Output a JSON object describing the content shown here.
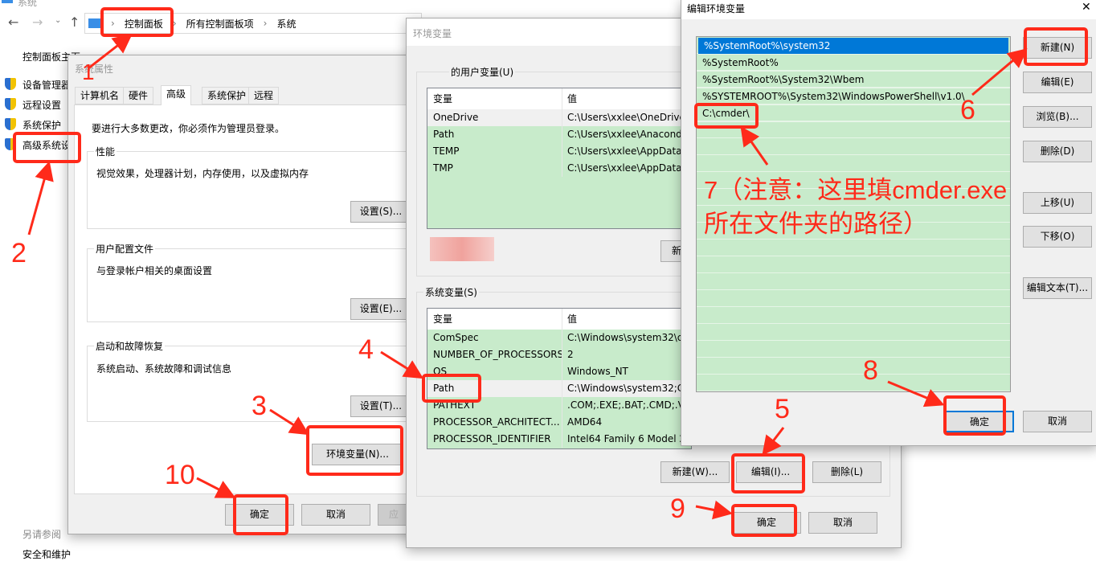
{
  "explorer": {
    "title": "系统",
    "breadcrumb": [
      "控制面板",
      "所有控制面板项",
      "系统"
    ],
    "nav_home": "控制面板主页",
    "nav_items": [
      "设备管理器",
      "远程设置",
      "系统保护",
      "高级系统设"
    ],
    "see_also": "另请参阅",
    "see_also_item": "安全和维护"
  },
  "sysprops": {
    "title": "系统属性",
    "tabs": [
      "计算机名",
      "硬件",
      "高级",
      "系统保护",
      "远程"
    ],
    "active_tab": "高级",
    "admin_note": "要进行大多数更改，你必须作为管理员登录。",
    "performance": {
      "label": "性能",
      "desc": "视觉效果，处理器计划，内存使用，以及虚拟内存",
      "button": "设置(S)..."
    },
    "profile": {
      "label": "用户配置文件",
      "desc": "与登录帐户相关的桌面设置",
      "button": "设置(E)..."
    },
    "startup": {
      "label": "启动和故障恢复",
      "desc": "系统启动、系统故障和调试信息",
      "button": "设置(T)..."
    },
    "env_button": "环境变量(N)...",
    "ok": "确定",
    "cancel": "取消",
    "apply": "应"
  },
  "envvars": {
    "title": "环境变量",
    "user_group": "的用户变量(U)",
    "col_var": "变量",
    "col_val": "值",
    "user_vars": [
      {
        "name": "OneDrive",
        "value": "C:\\Users\\xxlee\\OneDrive"
      },
      {
        "name": "Path",
        "value": "C:\\Users\\xxlee\\Anacond"
      },
      {
        "name": "TEMP",
        "value": "C:\\Users\\xxlee\\AppData\\"
      },
      {
        "name": "TMP",
        "value": "C:\\Users\\xxlee\\AppData\\"
      }
    ],
    "user_new": "新",
    "sys_group": "系统变量(S)",
    "sys_vars": [
      {
        "name": "ComSpec",
        "value": "C:\\Windows\\system32\\c"
      },
      {
        "name": "NUMBER_OF_PROCESSORS",
        "value": "2"
      },
      {
        "name": "OS",
        "value": "Windows_NT"
      },
      {
        "name": "Path",
        "value": "C:\\Windows\\system32;C"
      },
      {
        "name": "PATHEXT",
        "value": ".COM;.EXE;.BAT;.CMD;.V"
      },
      {
        "name": "PROCESSOR_ARCHITECT...",
        "value": "AMD64"
      },
      {
        "name": "PROCESSOR_IDENTIFIER",
        "value": "Intel64 Family 6 Model 2"
      }
    ],
    "new": "新建(W)...",
    "edit": "编辑(I)...",
    "delete": "删除(L)",
    "ok": "确定",
    "cancel": "取消"
  },
  "editenv": {
    "title": "编辑环境变量",
    "close": "✕",
    "entries": [
      "%SystemRoot%\\system32",
      "%SystemRoot%",
      "%SystemRoot%\\System32\\Wbem",
      "%SYSTEMROOT%\\System32\\WindowsPowerShell\\v1.0\\",
      "C:\\cmder\\"
    ],
    "buttons": [
      "新建(N)",
      "编辑(E)",
      "浏览(B)...",
      "删除(D)",
      "上移(U)",
      "下移(O)",
      "编辑文本(T)..."
    ],
    "ok": "确定",
    "cancel": "取消"
  },
  "annotations": {
    "steps": [
      "1",
      "2",
      "3",
      "4",
      "5",
      "6",
      "8",
      "9",
      "10"
    ],
    "note": "7（注意：这里填cmder.exe所在文件夹的路径）",
    "color": "#ff2a1a"
  }
}
